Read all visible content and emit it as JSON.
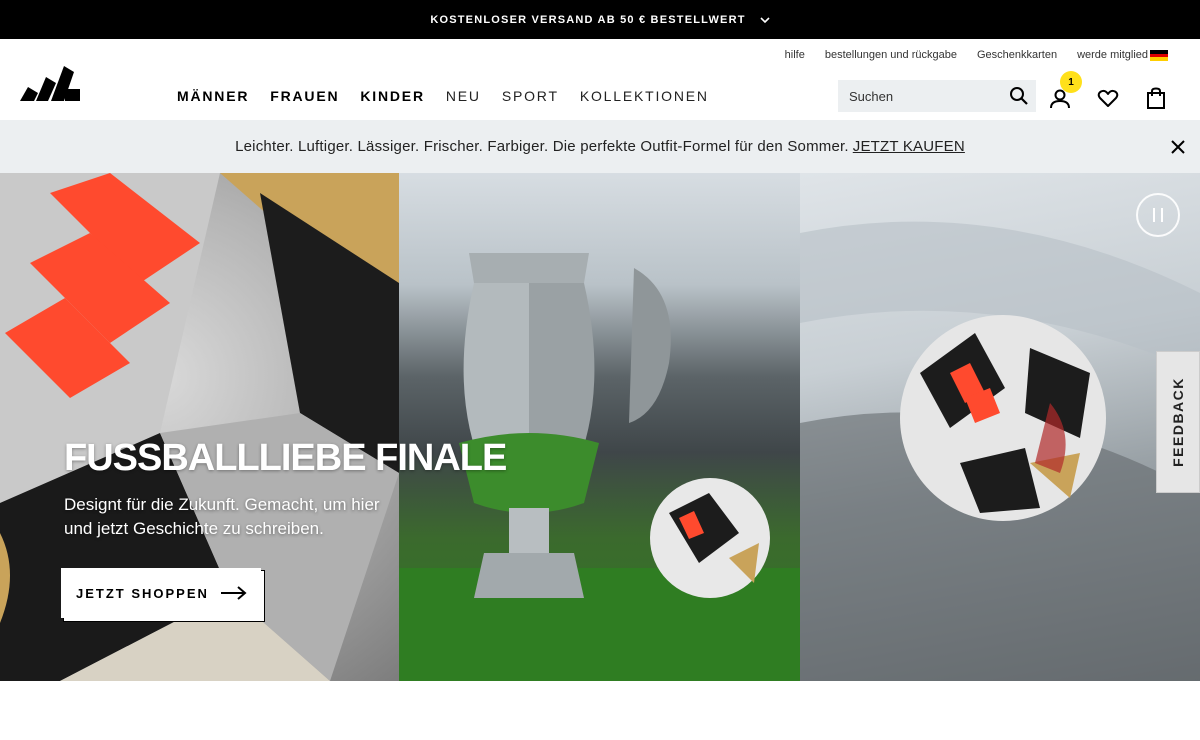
{
  "promo": {
    "text": "KOSTENLOSER VERSAND AB 50 € BESTELLWERT"
  },
  "util_links": [
    "hilfe",
    "bestellungen und rückgabe",
    "Geschenkkarten",
    "werde mitglied"
  ],
  "nav": [
    "MÄNNER",
    "FRAUEN",
    "KINDER",
    "NEU",
    "SPORT",
    "KOLLEKTIONEN"
  ],
  "search": {
    "placeholder": "Suchen"
  },
  "account": {
    "badge_count": "1"
  },
  "icons": {
    "search": "search-icon",
    "account": "user-icon",
    "wishlist": "heart-icon",
    "bag": "shopping-bag-icon",
    "close": "close-icon",
    "pause": "pause-icon",
    "arrow": "arrow-right-icon",
    "flag": "flag-germany-icon"
  },
  "announcement": {
    "text": "Leichter. Luftiger. Lässiger. Frischer. Farbiger. Die perfekte Outfit-Formel für den Sommer.",
    "link": "JETZT KAUFEN"
  },
  "hero": {
    "title": "FUSSBALLLIEBE FINALE",
    "subtitle": "Designt für die Zukunft. Gemacht, um hier und jetzt Geschichte zu schreiben.",
    "cta": "JETZT SHOPPEN"
  },
  "feedback": {
    "label": "FEEDBACK"
  },
  "colors": {
    "promo_bg": "#000000",
    "announce_bg": "#eceff1",
    "badge": "#ffe01b",
    "ball_accent": "#ff4a2e"
  }
}
